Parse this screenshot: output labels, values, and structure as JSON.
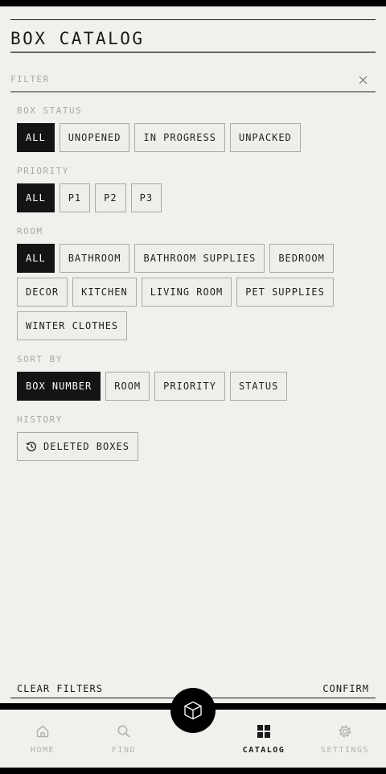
{
  "header": {
    "title": "BOX CATALOG"
  },
  "filter": {
    "placeholder": "FILTER"
  },
  "sections": {
    "box_status": {
      "label": "BOX STATUS",
      "options": [
        "ALL",
        "UNOPENED",
        "IN PROGRESS",
        "UNPACKED"
      ],
      "selected": "ALL"
    },
    "priority": {
      "label": "PRIORITY",
      "options": [
        "ALL",
        "P1",
        "P2",
        "P3"
      ],
      "selected": "ALL"
    },
    "room": {
      "label": "ROOM",
      "rows": [
        [
          "ALL",
          "BATHROOM",
          "BATHROOM SUPPLIES",
          "BEDROOM"
        ],
        [
          "DECOR",
          "KITCHEN",
          "LIVING ROOM",
          "PET SUPPLIES"
        ],
        [
          "WINTER CLOTHES"
        ]
      ],
      "selected": "ALL"
    },
    "sort_by": {
      "label": "SORT BY",
      "options": [
        "BOX NUMBER",
        "ROOM",
        "PRIORITY",
        "STATUS"
      ],
      "selected": "BOX NUMBER"
    },
    "history": {
      "label": "HISTORY",
      "button": "DELETED BOXES",
      "icon": "history-icon"
    }
  },
  "footer": {
    "clear": "CLEAR FILTERS",
    "confirm": "CONFIRM"
  },
  "nav": {
    "items": [
      {
        "label": "HOME",
        "icon": "home-icon"
      },
      {
        "label": "FIND",
        "icon": "search-icon"
      },
      {
        "label": "CATALOG",
        "icon": "grid-icon",
        "active": true
      },
      {
        "label": "SETTINGS",
        "icon": "gear-icon"
      }
    ],
    "fab_icon": "box-icon"
  },
  "colors": {
    "selected_bg": "#141414",
    "background": "#f1f0ec",
    "muted_text": "#a8a8a4",
    "border": "#a9a9a5"
  }
}
